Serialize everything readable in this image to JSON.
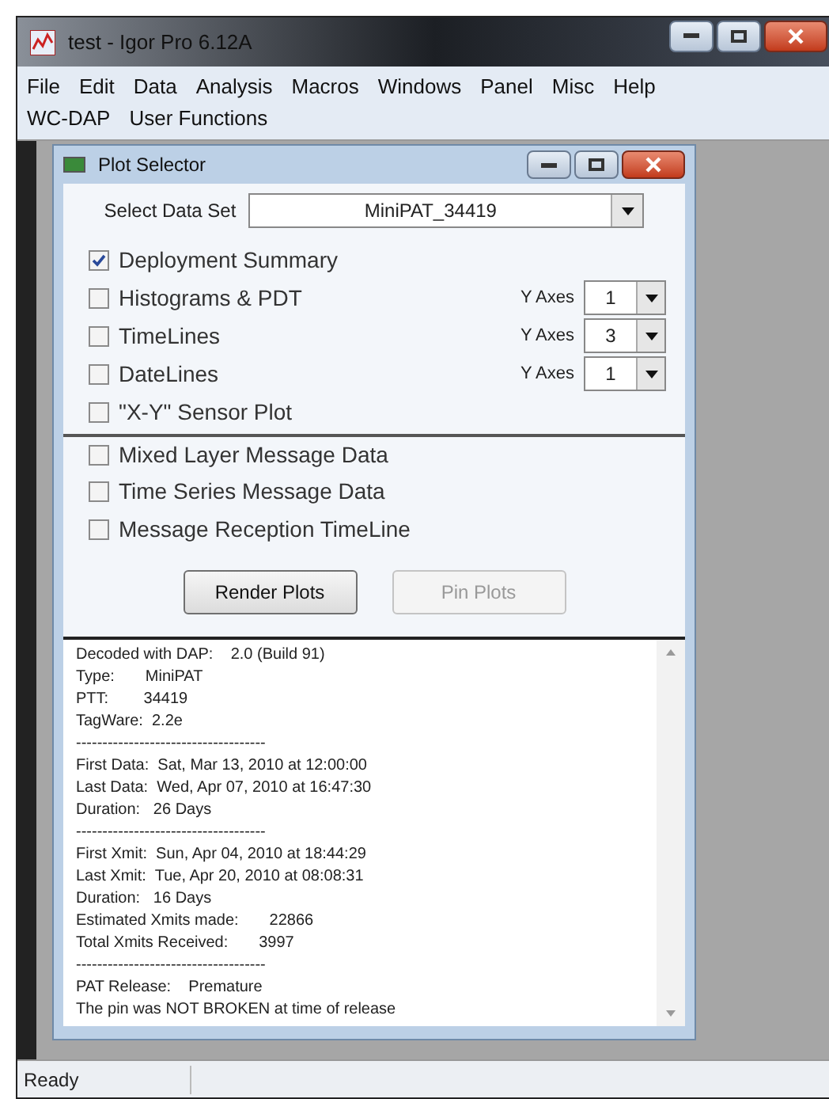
{
  "window": {
    "title": "test - Igor Pro 6.12A"
  },
  "menu_bar": [
    [
      "File",
      "Edit",
      "Data",
      "Analysis",
      "Macros",
      "Windows",
      "Panel",
      "Misc",
      "Help"
    ],
    [
      "WC-DAP",
      "User Functions"
    ]
  ],
  "plot_selector": {
    "title": "Plot Selector",
    "data_set_label": "Select Data Set",
    "data_set": "MiniPAT_34419",
    "options": [
      [
        {
          "label": "Deployment Summary",
          "checked": true
        },
        {
          "label": "Histograms & PDT",
          "checked": false,
          "axes_label": "Y Axes",
          "axes": "1"
        },
        {
          "label": "TimeLines",
          "checked": false,
          "axes_label": "Y Axes",
          "axes": "3"
        },
        {
          "label": "DateLines",
          "checked": false,
          "axes_label": "Y Axes",
          "axes": "1"
        },
        {
          "label": "\"X-Y\" Sensor Plot",
          "checked": false
        }
      ],
      [
        {
          "label": "Mixed Layer Message Data",
          "checked": false
        },
        {
          "label": "Time Series Message Data",
          "checked": false
        },
        {
          "label": "Message Reception TimeLine",
          "checked": false
        }
      ]
    ],
    "buttons": [
      {
        "label": "Render Plots",
        "disabled": false
      },
      {
        "label": "Pin Plots",
        "disabled": true
      }
    ],
    "report": [
      "Decoded with DAP:    2.0 (Build 91)",
      "Type:       MiniPAT",
      "PTT:        34419",
      "TagWare:  2.2e",
      "------------------------------------",
      "First Data:  Sat, Mar 13, 2010 at 12:00:00",
      "Last Data:  Wed, Apr 07, 2010 at 16:47:30",
      "Duration:   26 Days",
      "------------------------------------",
      "First Xmit:  Sun, Apr 04, 2010 at 18:44:29",
      "Last Xmit:  Tue, Apr 20, 2010 at 08:08:31",
      "Duration:   16 Days",
      "Estimated Xmits made:       22866",
      "Total Xmits Received:       3997",
      "------------------------------------",
      "PAT Release:    Premature",
      "The pin was NOT BROKEN at time of release"
    ]
  },
  "status_bar": "Ready"
}
